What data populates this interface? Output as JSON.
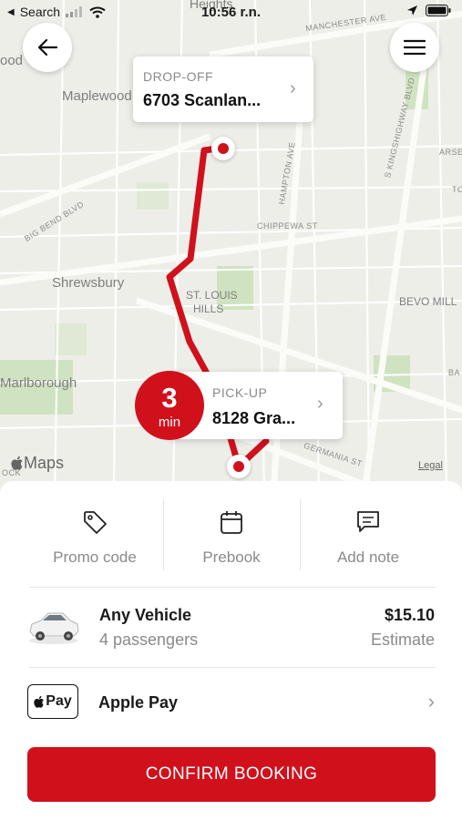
{
  "status_bar": {
    "back_app": "Search",
    "time": "10:56 r.n."
  },
  "map": {
    "places": [
      "Maplewood",
      "Shrewsbury",
      "Marlborough",
      "ST. LOUIS",
      "HILLS",
      "BEVO MILL",
      "Heights",
      "ood"
    ],
    "streets": [
      "MANCHESTER AVE",
      "CHIPPEWA ST",
      "HAMPTON AVE",
      "BIG BEND BLVD",
      "S KINGSHIGHWAY BLVD",
      "GERMANIA ST",
      "ARSE",
      "TO",
      "BA",
      "OCK"
    ],
    "attribution": "Maps",
    "legal": "Legal"
  },
  "dropoff": {
    "label": "DROP-OFF",
    "address": "6703 Scanlan..."
  },
  "pickup": {
    "label": "PICK-UP",
    "address": "8128 Gra...",
    "eta_value": "3",
    "eta_unit": "min"
  },
  "actions": [
    {
      "label": "Promo code",
      "icon": "tag-icon"
    },
    {
      "label": "Prebook",
      "icon": "calendar-icon"
    },
    {
      "label": "Add note",
      "icon": "note-icon"
    }
  ],
  "vehicle": {
    "name": "Any Vehicle",
    "capacity": "4 passengers",
    "price": "$15.10",
    "price_note": "Estimate"
  },
  "payment": {
    "badge": "Pay",
    "method": "Apple Pay"
  },
  "confirm_label": "CONFIRM BOOKING",
  "colors": {
    "accent": "#d0111c",
    "map_bg": "#eeeee9",
    "park": "#cfe3c0"
  }
}
